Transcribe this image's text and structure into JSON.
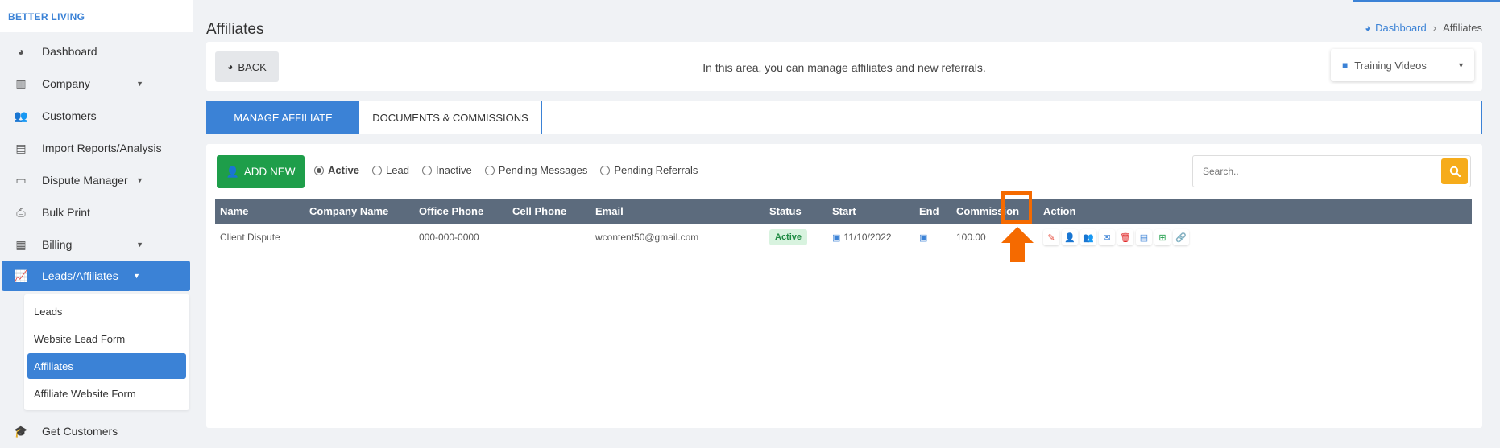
{
  "brand": "BETTER LIVING",
  "sidebar": {
    "items": [
      {
        "label": "Dashboard",
        "icon": "pie-chart-icon"
      },
      {
        "label": "Company",
        "icon": "building-icon"
      },
      {
        "label": "Customers",
        "icon": "users-icon"
      },
      {
        "label": "Import Reports/Analysis",
        "icon": "file-import-icon"
      },
      {
        "label": "Dispute Manager",
        "icon": "laptop-icon"
      },
      {
        "label": "Bulk Print",
        "icon": "printer-icon"
      },
      {
        "label": "Billing",
        "icon": "receipt-icon"
      },
      {
        "label": "Leads/Affiliates",
        "icon": "chart-line-icon"
      }
    ],
    "submenu": [
      "Leads",
      "Website Lead Form",
      "Affiliates",
      "Affiliate Website Form"
    ],
    "last_item": {
      "label": "Get Customers",
      "icon": "graduation-cap-icon"
    }
  },
  "page": {
    "title": "Affiliates",
    "breadcrumb": {
      "home": "Dashboard",
      "current": "Affiliates"
    }
  },
  "toolbar": {
    "back_label": "BACK",
    "message": "In this area, you can manage affiliates and new referrals.",
    "training_label": "Training Videos"
  },
  "tabs": [
    "MANAGE AFFILIATE",
    "DOCUMENTS & COMMISSIONS"
  ],
  "panel": {
    "add_label": "ADD NEW",
    "filters": [
      "Active",
      "Lead",
      "Inactive",
      "Pending Messages",
      "Pending Referrals"
    ],
    "selected_filter": "Active",
    "search_placeholder": "Search.."
  },
  "table": {
    "headers": [
      "Name",
      "Company Name",
      "Office Phone",
      "Cell Phone",
      "Email",
      "Status",
      "Start",
      "End",
      "Commission",
      "Action"
    ],
    "rows": [
      {
        "name": "Client Dispute",
        "company": "",
        "office_phone": "000-000-0000",
        "cell_phone": "",
        "email": "wcontent50@gmail.com",
        "status": "Active",
        "start": "11/10/2022",
        "end": "",
        "commission": "100.00"
      }
    ],
    "action_icons": [
      {
        "name": "edit-icon",
        "color": "#e74c3c"
      },
      {
        "name": "user-plus-icon",
        "color": "#f6ac1b"
      },
      {
        "name": "users-icon",
        "color": "#1e9e4a"
      },
      {
        "name": "envelope-icon",
        "color": "#3b82d6"
      },
      {
        "name": "trash-icon",
        "color": "#e02424"
      },
      {
        "name": "document-icon",
        "color": "#3b82d6"
      },
      {
        "name": "plus-square-icon",
        "color": "#1e9e4a"
      },
      {
        "name": "link-icon",
        "color": "#e05a8a"
      }
    ]
  },
  "colors": {
    "accent": "#3b82d6",
    "success": "#1e9e4a",
    "warning": "#f6ac1b",
    "highlight": "#f56a00"
  }
}
